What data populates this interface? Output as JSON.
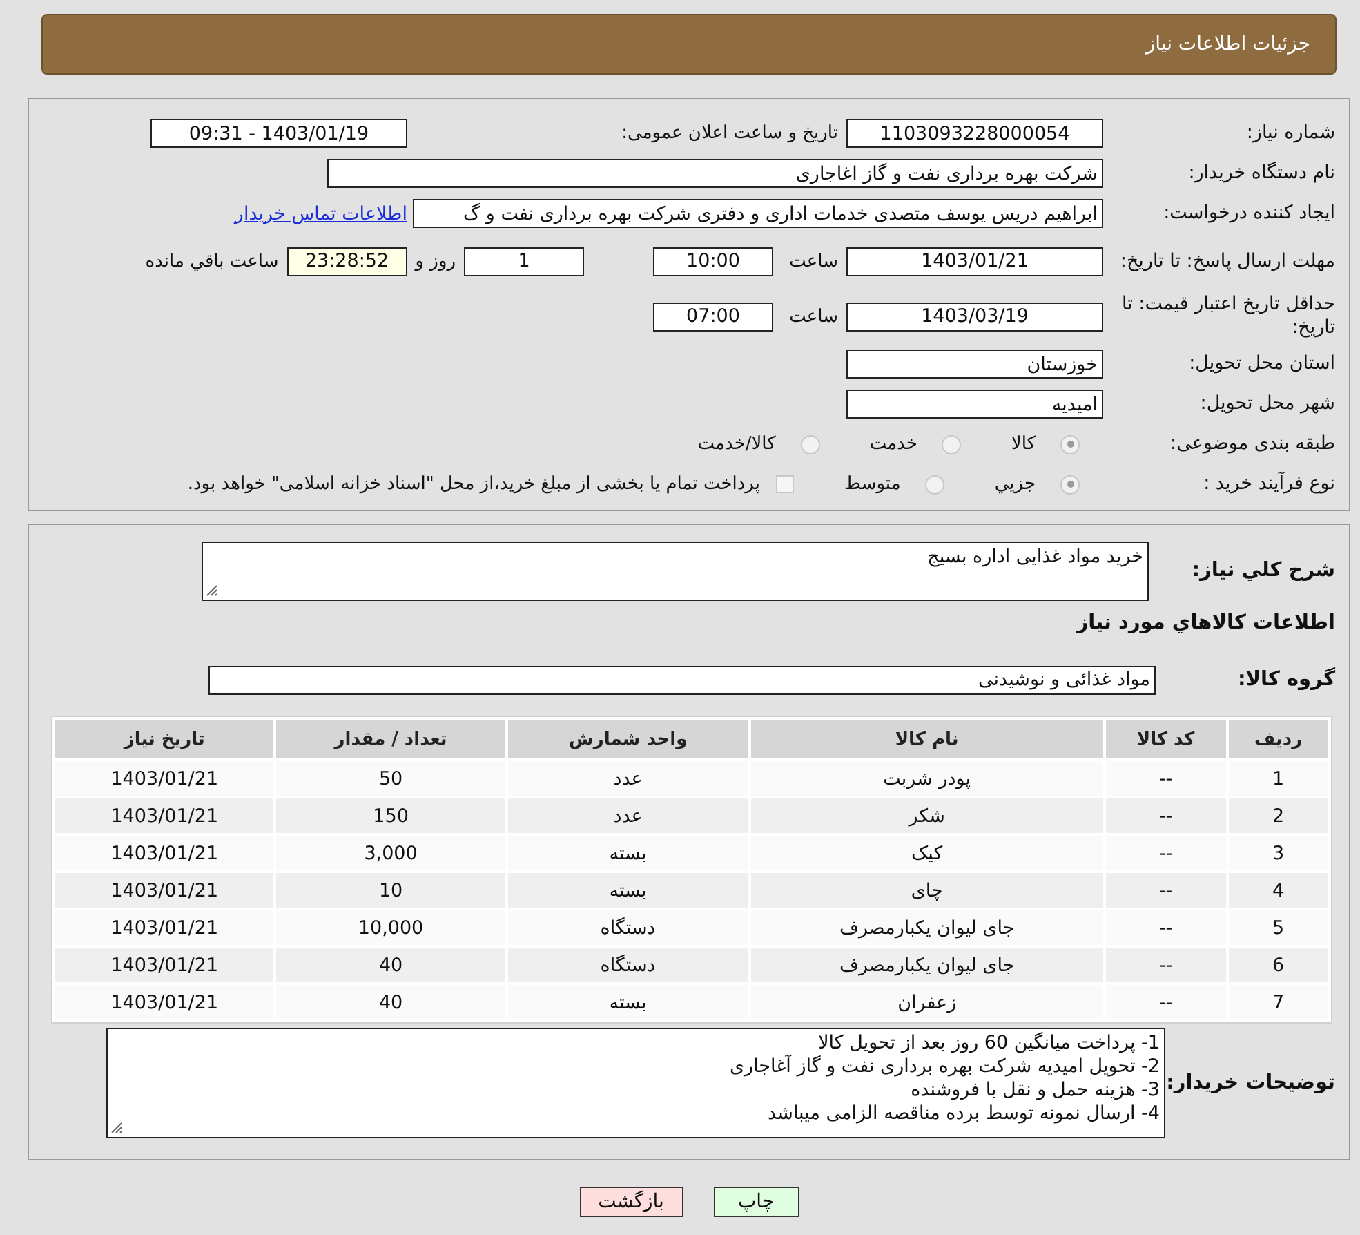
{
  "header": {
    "title": "جزئیات اطلاعات نیاز"
  },
  "need_number": {
    "label": "شماره نیاز:",
    "value": "1103093228000054"
  },
  "announce": {
    "label": "تاریخ و ساعت اعلان عمومی:",
    "value": "1403/01/19 - 09:31"
  },
  "buyer_org": {
    "label": "نام دستگاه خریدار:",
    "value": "شرکت بهره برداری نفت و گاز اغاجاری"
  },
  "requester": {
    "label": "ایجاد کننده درخواست:",
    "value": "ابراهیم دریس یوسف متصدی خدمات اداری و دفتری شرکت بهره برداری نفت و گ",
    "link": "اطلاعات تماس خریدار"
  },
  "deadline": {
    "label": "مهلت ارسال پاسخ: تا تاریخ:",
    "date": "1403/01/21",
    "time_label": "ساعت",
    "time": "10:00",
    "days": "1",
    "days_label": "روز و",
    "remaining": "23:28:52",
    "remaining_label": "ساعت باقي مانده"
  },
  "price_validity": {
    "label": "حداقل تاریخ اعتبار قیمت: تا تاریخ:",
    "date": "1403/03/19",
    "time_label": "ساعت",
    "time": "07:00"
  },
  "province": {
    "label": "استان محل تحویل:",
    "value": "خوزستان"
  },
  "city": {
    "label": "شهر محل تحویل:",
    "value": "امیدیه"
  },
  "category": {
    "label": "طبقه بندی موضوعی:",
    "options": [
      {
        "label": "كالا",
        "selected": true
      },
      {
        "label": "خدمت",
        "selected": false
      },
      {
        "label": "كالا/خدمت",
        "selected": false
      }
    ]
  },
  "purchase_type": {
    "label": "نوع فرآیند خرید :",
    "options": [
      {
        "label": "جزيي",
        "selected": true
      },
      {
        "label": "متوسط",
        "selected": false
      }
    ],
    "payment": {
      "label": "پرداخت تمام یا بخشی از مبلغ خرید،از محل \"اسناد خزانه اسلامی\" خواهد بود.",
      "checked": false
    }
  },
  "description": {
    "label": "شرح كلي نیاز:",
    "value": "خرید مواد غذایی اداره بسیج"
  },
  "goods_heading": "اطلاعات كالاهاي مورد نیاز",
  "goods_group": {
    "label": "گروه كالا:",
    "value": "مواد غذائی و نوشیدنی"
  },
  "table": {
    "columns": [
      "ردیف",
      "کد کالا",
      "نام کالا",
      "واحد شمارش",
      "تعداد / مقدار",
      "تاریخ نیاز"
    ],
    "rows": [
      [
        "1",
        "--",
        "پودر شربت",
        "عدد",
        "50",
        "1403/01/21"
      ],
      [
        "2",
        "--",
        "شکر",
        "عدد",
        "150",
        "1403/01/21"
      ],
      [
        "3",
        "--",
        "کیک",
        "بسته",
        "3,000",
        "1403/01/21"
      ],
      [
        "4",
        "--",
        "چای",
        "بسته",
        "10",
        "1403/01/21"
      ],
      [
        "5",
        "--",
        "جای لیوان یکبارمصرف",
        "دستگاه",
        "10,000",
        "1403/01/21"
      ],
      [
        "6",
        "--",
        "جای لیوان یکبارمصرف",
        "دستگاه",
        "40",
        "1403/01/21"
      ],
      [
        "7",
        "--",
        "زعفران",
        "بسته",
        "40",
        "1403/01/21"
      ]
    ]
  },
  "notes": {
    "label": "توضیحات خریدار:",
    "lines": [
      "1- پرداخت میانگین 60 روز بعد از تحویل کالا",
      "2- تحویل امیدیه شرکت بهره برداری نفت و گاز آغاجاری",
      "3- هزینه حمل و نقل با فروشنده",
      "4- ارسال نمونه توسط برده مناقصه الزامی میباشد"
    ]
  },
  "buttons": [
    {
      "label": "چاپ",
      "kind": "print"
    },
    {
      "label": "بازگشت",
      "kind": "back"
    }
  ]
}
